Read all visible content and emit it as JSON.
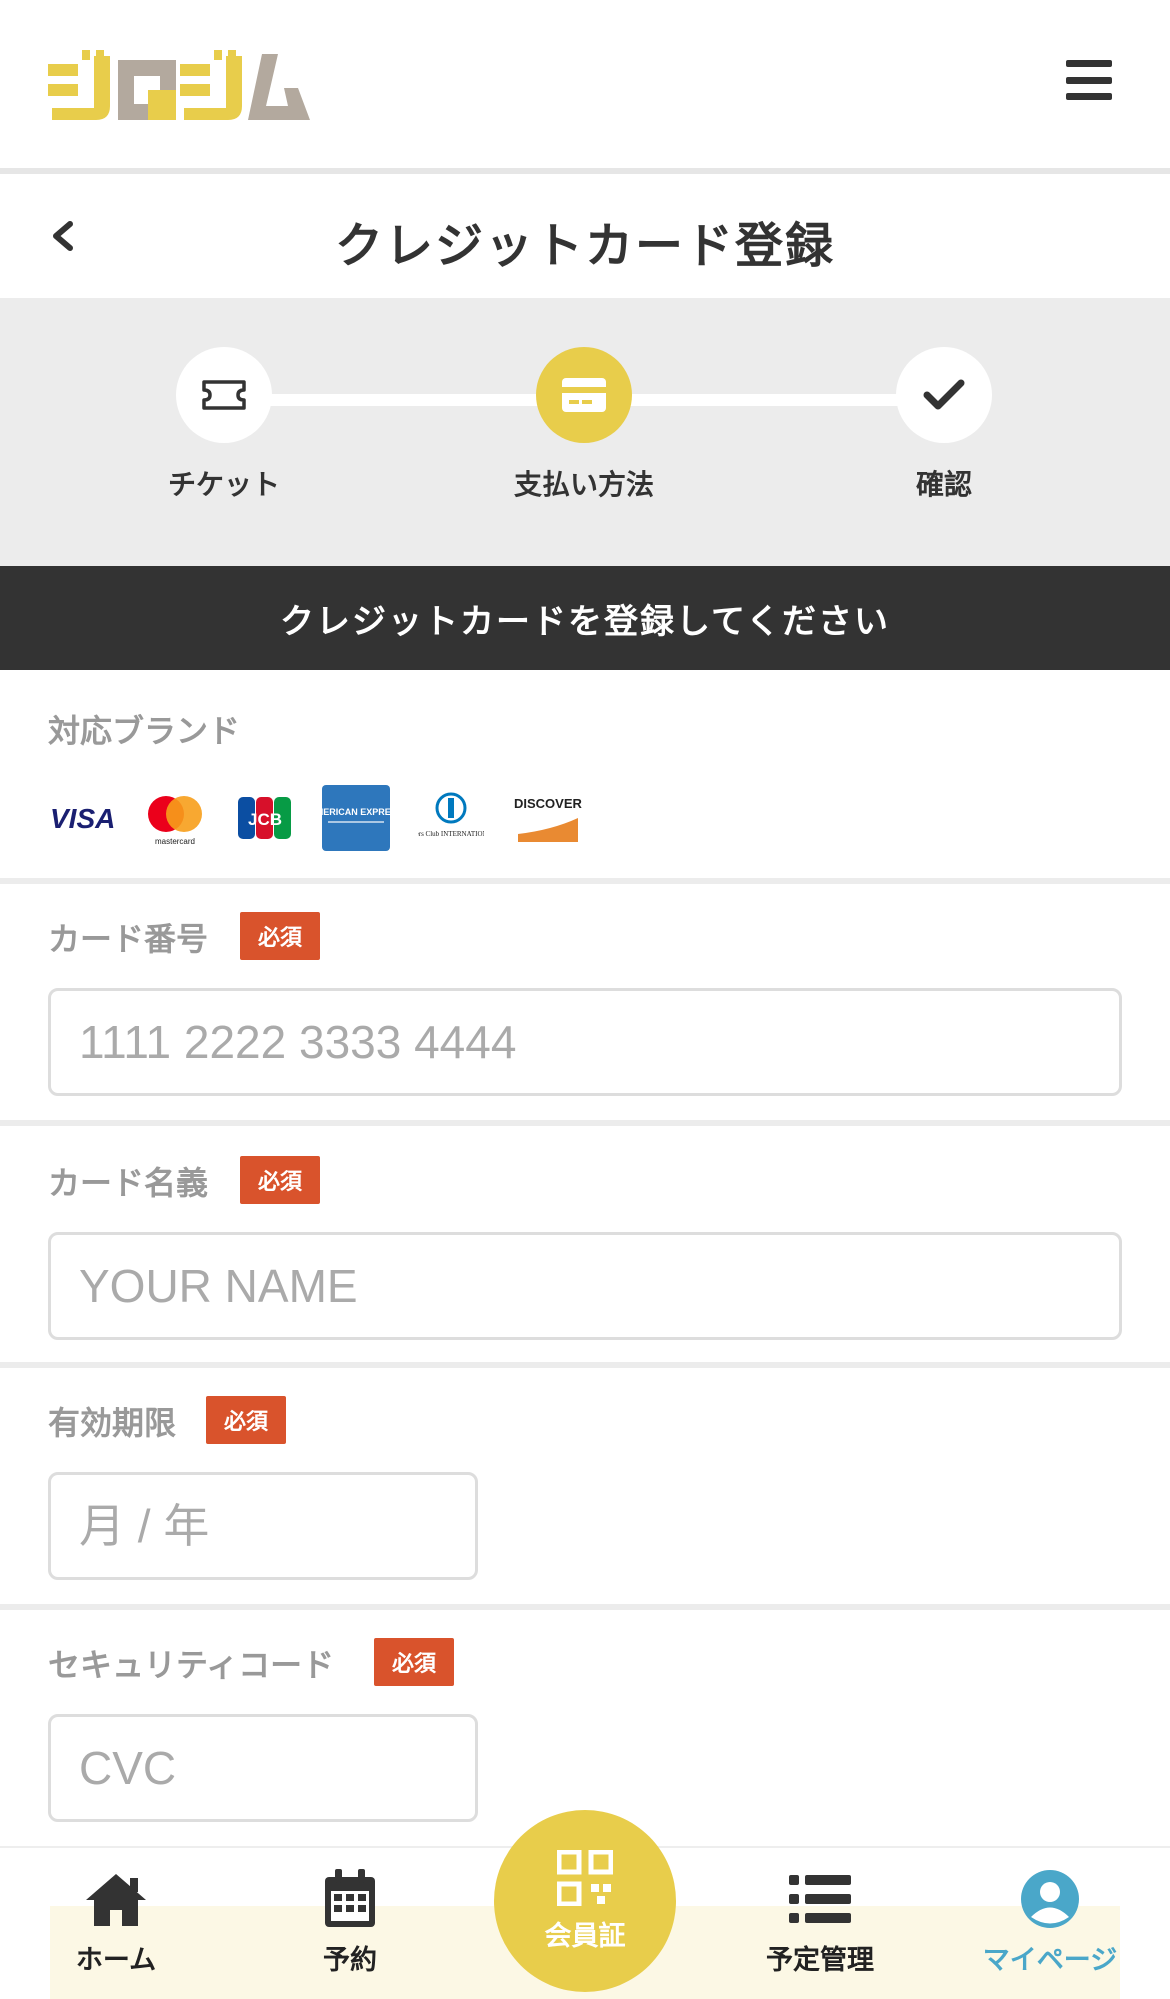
{
  "header": {
    "logo_text": "ジロジム",
    "menu_icon": "hamburger-menu-icon"
  },
  "title_bar": {
    "back_icon": "chevron-left-icon",
    "title": "クレジットカード登録"
  },
  "stepper": {
    "steps": [
      {
        "label": "チケット",
        "icon": "ticket-icon",
        "active": false
      },
      {
        "label": "支払い方法",
        "icon": "credit-card-icon",
        "active": true
      },
      {
        "label": "確認",
        "icon": "checkmark-icon",
        "active": false
      }
    ]
  },
  "banner": {
    "text": "クレジットカードを登録してください"
  },
  "brands": {
    "label": "対応ブランド",
    "items": [
      {
        "name": "VISA"
      },
      {
        "name": "mastercard"
      },
      {
        "name": "JCB"
      },
      {
        "name": "AMERICAN EXPRESS"
      },
      {
        "name": "Diners Club INTERNATIONAL"
      },
      {
        "name": "DISCOVER"
      }
    ]
  },
  "form": {
    "required_label": "必須",
    "card_number": {
      "label": "カード番号",
      "placeholder": "1111 2222 3333 4444",
      "value": ""
    },
    "card_name": {
      "label": "カード名義",
      "placeholder": "YOUR NAME",
      "value": ""
    },
    "expiry": {
      "label": "有効期限",
      "placeholder": "月 / 年",
      "value": ""
    },
    "cvc": {
      "label": "セキュリティコード",
      "placeholder": "CVC",
      "value": ""
    }
  },
  "bottom_nav": {
    "items": [
      {
        "label": "ホーム",
        "icon": "home-icon"
      },
      {
        "label": "予約",
        "icon": "calendar-icon"
      },
      {
        "label": "会員証",
        "icon": "qr-code-icon"
      },
      {
        "label": "予定管理",
        "icon": "list-icon"
      },
      {
        "label": "マイページ",
        "icon": "user-icon",
        "active": true
      }
    ]
  },
  "colors": {
    "accent_yellow": "#e8cd4b",
    "logo_gray": "#b3a99e",
    "required_red": "#d9532c",
    "banner_dark": "#333333",
    "active_blue": "#4aa7c9"
  }
}
